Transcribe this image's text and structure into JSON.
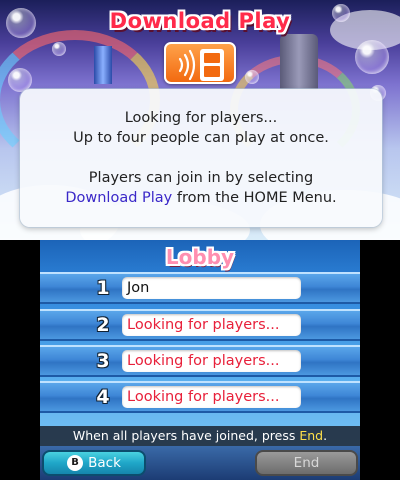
{
  "top_screen": {
    "title": "Download Play",
    "message_line1": "Looking for players...",
    "message_line2": "Up to four people can play at once.",
    "message_line3": "Players can join in by selecting",
    "message_line4_highlight": "Download Play",
    "message_line4_rest": " from the HOME Menu.",
    "icon": "download-play-icon",
    "highlight_color": "#3a28c8"
  },
  "lobby": {
    "title": "Lobby",
    "slots": [
      {
        "number": "1",
        "name": "Jon",
        "status": "joined"
      },
      {
        "number": "2",
        "name": "Looking for players...",
        "status": "waiting"
      },
      {
        "number": "3",
        "name": "Looking for players...",
        "status": "waiting"
      },
      {
        "number": "4",
        "name": "Looking for players...",
        "status": "waiting"
      }
    ],
    "instruction_prefix": "When all players have joined, press ",
    "instruction_keyword": "End",
    "instruction_suffix": ".",
    "back_button": {
      "glyph": "B",
      "label": "Back"
    },
    "end_button": {
      "label": "End",
      "enabled": false
    },
    "waiting_color": "#e8203a",
    "keyword_color": "#ffe04a"
  }
}
